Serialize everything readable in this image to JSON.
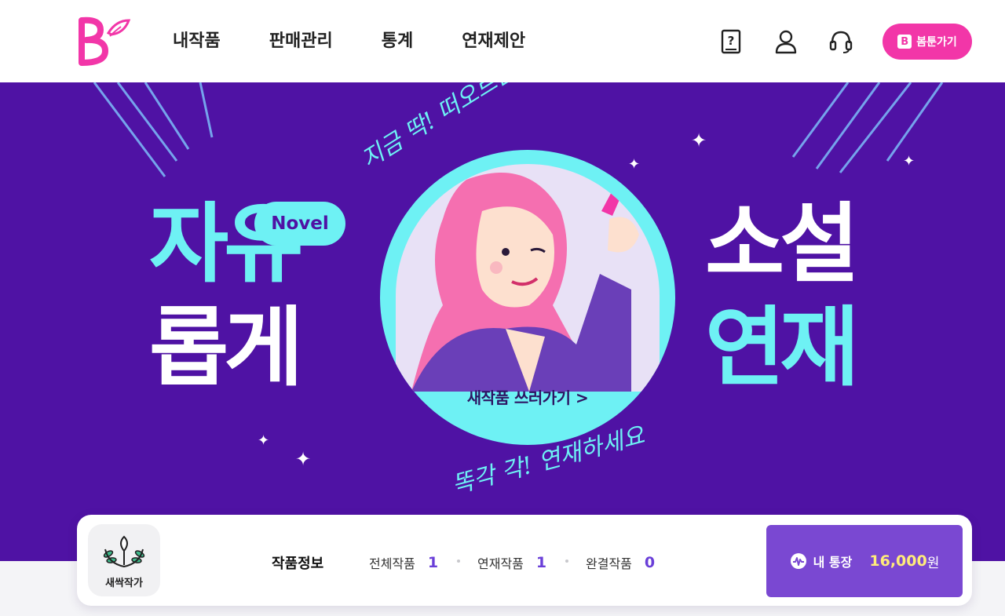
{
  "header": {
    "logo_icon": "bomtoon-b-logo",
    "nav": [
      "내작품",
      "판매관리",
      "통계",
      "연재제안"
    ],
    "icons": [
      "help-book-icon",
      "user-icon",
      "headset-icon"
    ],
    "bomtoon_button": "봄툰가기",
    "brand_color": "#f236a8"
  },
  "banner": {
    "left_top": "자유",
    "left_bottom": "롭게",
    "novel_pill": "Novel",
    "right_top": "소설",
    "right_bottom": "연재",
    "handwriting_top": "지금 딱! 떠오르는 이야기",
    "handwriting_bottom": "똑각 각! 연재하세요",
    "cta": "새작품 쓰러가기 >",
    "bg_color": "#4f12a4",
    "accent_color": "#6ef1f4"
  },
  "profile_card": {
    "badge_label": "새싹작가",
    "badge_icon": "sprout-laurel-icon",
    "info_title": "작품정보",
    "stats": [
      {
        "label": "전체작품",
        "value": "1"
      },
      {
        "label": "연재작품",
        "value": "1"
      },
      {
        "label": "완결작품",
        "value": "0"
      }
    ],
    "wallet": {
      "icon": "wallet-wave-icon",
      "label": "내 통장",
      "amount": "16,000",
      "currency": "원"
    }
  }
}
